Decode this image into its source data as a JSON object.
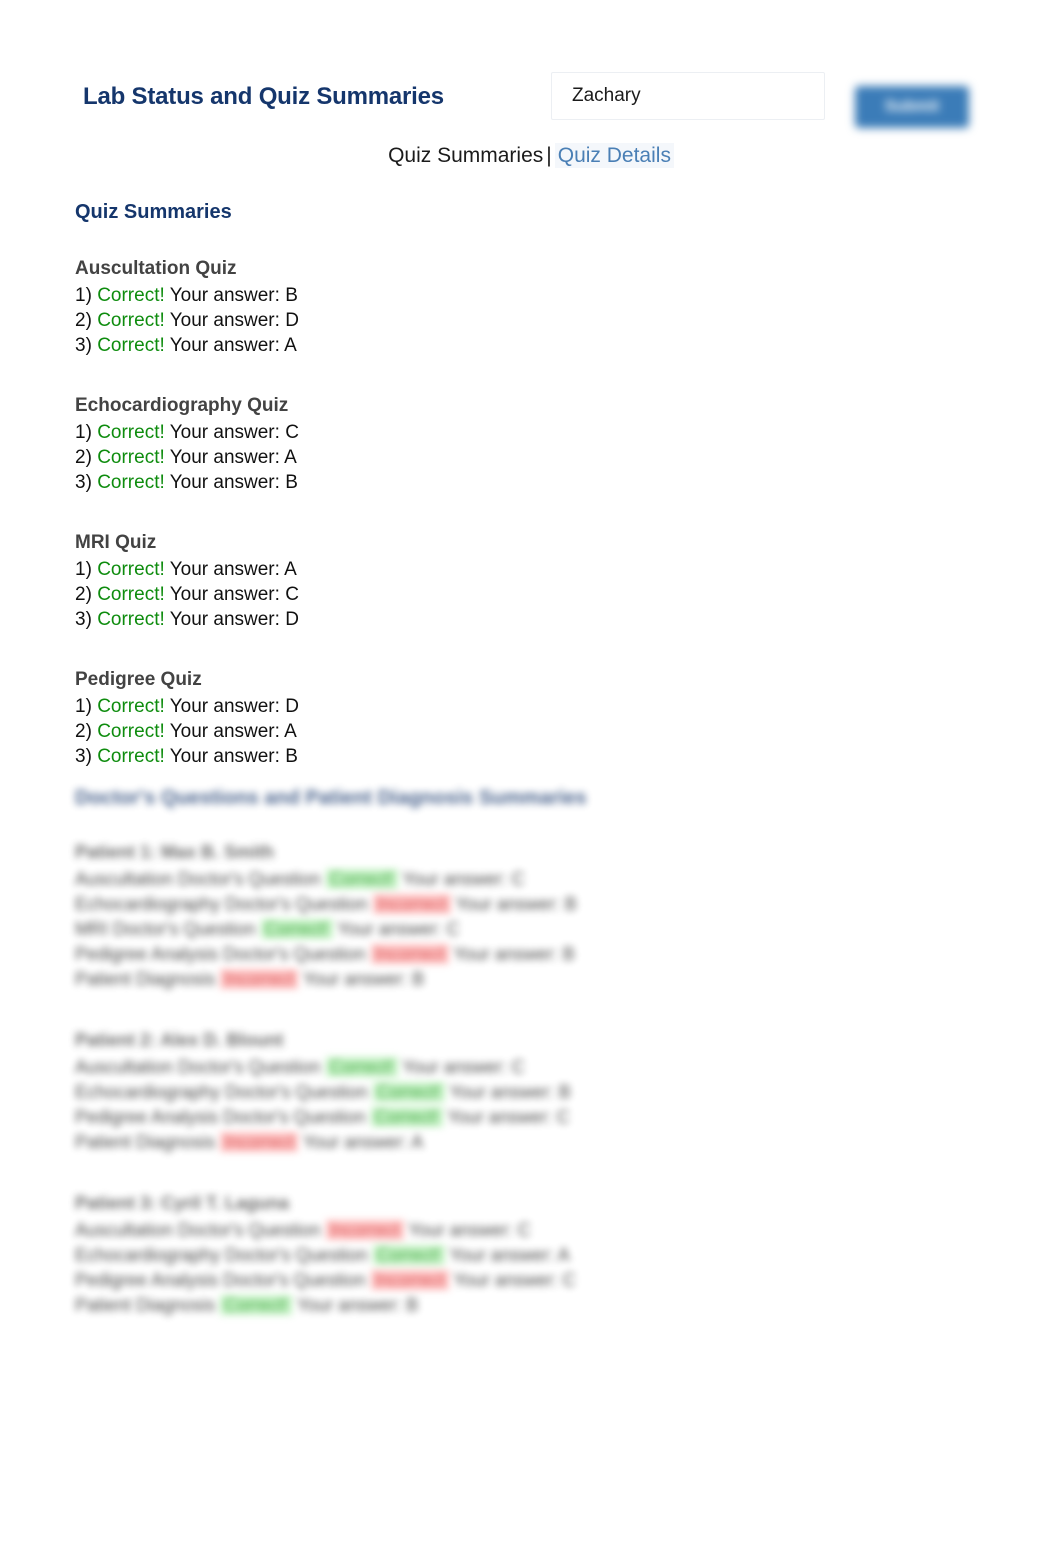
{
  "header": {
    "title": "Lab Status and Quiz Summaries",
    "name_input_value": "Zachary",
    "name_input_placeholder": "",
    "submit_label": "Submit",
    "accent_navy": "#15366c",
    "accent_button": "#3b7cb8"
  },
  "nav": {
    "current_label": "Quiz Summaries",
    "separator": "|",
    "link_label": "Quiz Details",
    "link_color": "#4a7fb5"
  },
  "main": {
    "section_heading": "Quiz Summaries",
    "correct_color": "#0e8c0e",
    "incorrect_color": "#cc2222",
    "quizzes": [
      {
        "name": "Auscultation Quiz",
        "rows": [
          {
            "num": "1)",
            "result": "Correct!",
            "status": "correct",
            "answer_label": "Your answer:",
            "answer": "B"
          },
          {
            "num": "2)",
            "result": "Correct!",
            "status": "correct",
            "answer_label": "Your answer:",
            "answer": "D"
          },
          {
            "num": "3)",
            "result": "Correct!",
            "status": "correct",
            "answer_label": "Your answer:",
            "answer": "A"
          }
        ]
      },
      {
        "name": "Echocardiography Quiz",
        "rows": [
          {
            "num": "1)",
            "result": "Correct!",
            "status": "correct",
            "answer_label": "Your answer:",
            "answer": "C"
          },
          {
            "num": "2)",
            "result": "Correct!",
            "status": "correct",
            "answer_label": "Your answer:",
            "answer": "A"
          },
          {
            "num": "3)",
            "result": "Correct!",
            "status": "correct",
            "answer_label": "Your answer:",
            "answer": "B"
          }
        ]
      },
      {
        "name": "MRI Quiz",
        "rows": [
          {
            "num": "1)",
            "result": "Correct!",
            "status": "correct",
            "answer_label": "Your answer:",
            "answer": "A"
          },
          {
            "num": "2)",
            "result": "Correct!",
            "status": "correct",
            "answer_label": "Your answer:",
            "answer": "C"
          },
          {
            "num": "3)",
            "result": "Correct!",
            "status": "correct",
            "answer_label": "Your answer:",
            "answer": "D"
          }
        ]
      },
      {
        "name": "Pedigree Quiz",
        "rows": [
          {
            "num": "1)",
            "result": "Correct!",
            "status": "correct",
            "answer_label": "Your answer:",
            "answer": "D"
          },
          {
            "num": "2)",
            "result": "Correct!",
            "status": "correct",
            "answer_label": "Your answer:",
            "answer": "A"
          },
          {
            "num": "3)",
            "result": "Correct!",
            "status": "correct",
            "answer_label": "Your answer:",
            "answer": "B"
          }
        ]
      }
    ]
  },
  "blurred": {
    "heading": "Doctor's Questions and Patient Diagnosis Summaries",
    "note": "This region is rendered blurred in the screenshot and its text is not legible.",
    "patients": [
      {
        "name": "Patient 1: Max B. Smith",
        "rows": [
          {
            "label": "Auscultation Doctor's Question",
            "result": "Correct!",
            "status": "correct",
            "answer_label": "Your answer:",
            "answer": "C"
          },
          {
            "label": "Echocardiography Doctor's Question",
            "result": "Incorrect",
            "status": "incorrect",
            "answer_label": "Your answer:",
            "answer": "B"
          },
          {
            "label": "MRI Doctor's Question",
            "result": "Correct!",
            "status": "correct",
            "answer_label": "Your answer:",
            "answer": "C"
          },
          {
            "label": "Pedigree Analysis Doctor's Question",
            "result": "Incorrect",
            "status": "incorrect",
            "answer_label": "Your answer:",
            "answer": "B"
          },
          {
            "label": "Patient Diagnosis",
            "result": "Incorrect",
            "status": "incorrect",
            "answer_label": "Your answer:",
            "answer": "B"
          }
        ]
      },
      {
        "name": "Patient 2: Alex D. Blount",
        "rows": [
          {
            "label": "Auscultation Doctor's Question",
            "result": "Correct!",
            "status": "correct",
            "answer_label": "Your answer:",
            "answer": "C"
          },
          {
            "label": "Echocardiography Doctor's Question",
            "result": "Correct!",
            "status": "correct",
            "answer_label": "Your answer:",
            "answer": "B"
          },
          {
            "label": "Pedigree Analysis Doctor's Question",
            "result": "Correct!",
            "status": "correct",
            "answer_label": "Your answer:",
            "answer": "C"
          },
          {
            "label": "Patient Diagnosis",
            "result": "Incorrect",
            "status": "incorrect",
            "answer_label": "Your answer:",
            "answer": "A"
          }
        ]
      },
      {
        "name": "Patient 3: Cyril T. Laguna",
        "rows": [
          {
            "label": "Auscultation Doctor's Question",
            "result": "Incorrect",
            "status": "incorrect",
            "answer_label": "Your answer:",
            "answer": "C"
          },
          {
            "label": "Echocardiography Doctor's Question",
            "result": "Correct!",
            "status": "correct",
            "answer_label": "Your answer:",
            "answer": "A"
          },
          {
            "label": "Pedigree Analysis Doctor's Question",
            "result": "Incorrect",
            "status": "incorrect",
            "answer_label": "Your answer:",
            "answer": "C"
          },
          {
            "label": "Patient Diagnosis",
            "result": "Correct!",
            "status": "correct",
            "answer_label": "Your answer:",
            "answer": "B"
          }
        ]
      }
    ]
  }
}
